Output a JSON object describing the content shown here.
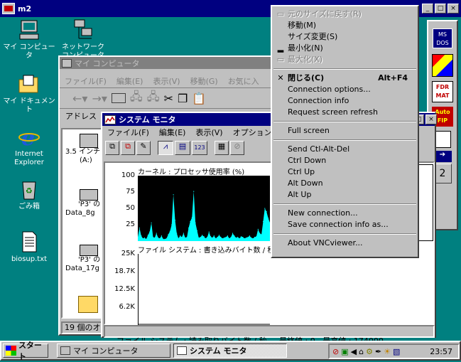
{
  "desktop": {
    "icons": [
      {
        "label1": "マイ コンピュータ",
        "label2": ""
      },
      {
        "label1": "ネットワーク",
        "label2": "コンピュータ"
      },
      {
        "label1": "マイ ドキュメント",
        "label2": ""
      },
      {
        "label1": "Internet",
        "label2": "Explorer"
      },
      {
        "label1": "ごみ箱",
        "label2": ""
      },
      {
        "label1": "biosup.txt",
        "label2": ""
      }
    ],
    "right_icons": [
      "MS DOS",
      "",
      "FDR MAT",
      "Auto FIP",
      "",
      ""
    ]
  },
  "vnc": {
    "title": "m2"
  },
  "mycomputer": {
    "title": "マイ コンピュータ",
    "menu": [
      "ファイル(F)",
      "編集(E)",
      "表示(V)",
      "移動(G)",
      "お気に入"
    ],
    "address_label": "アドレス",
    "items": [
      {
        "l1": "3.5 インチ",
        "l2": "(A:)"
      },
      {
        "l1": "'P3' の",
        "l2": "Data_8g"
      },
      {
        "l1": "'P3' の",
        "l2": "Data_17g"
      }
    ],
    "status": "19 個のオ"
  },
  "sysmon": {
    "title": "システム モニタ",
    "menu": [
      "ファイル(F)",
      "編集(E)",
      "表示(V)",
      "オプション(O)"
    ],
    "chart1_title": "カーネル : プロセッサ使用率 (%)",
    "chart2_title": "ファイル システム : 書き込みバイト数 / 秒",
    "status": "ファイル システム : 読み取りバイト数 / 秒     最終値 : 0   最高値 : 174000",
    "toolbar_text": "123"
  },
  "chart_data": [
    {
      "type": "area",
      "title": "カーネル : プロセッサ使用率 (%)",
      "yticks": [
        "100",
        "75",
        "50",
        "25"
      ],
      "ylim": [
        0,
        100
      ],
      "values": [
        6,
        20,
        8,
        4,
        5,
        3,
        9,
        14,
        28,
        6,
        5,
        12,
        5,
        4,
        8,
        3,
        3,
        4,
        10,
        15,
        25,
        71,
        32,
        12,
        4,
        8,
        6,
        12,
        5,
        6,
        20,
        30,
        36,
        76,
        28,
        16,
        5,
        6,
        9,
        7,
        4,
        6,
        14,
        7,
        5,
        8,
        4,
        6,
        9,
        6,
        4,
        5,
        6,
        8,
        4,
        6,
        12,
        8,
        5,
        6,
        4,
        7,
        6,
        4,
        5,
        6,
        8,
        5,
        4,
        6,
        7,
        18,
        12,
        10,
        30,
        50,
        45,
        35,
        28
      ]
    },
    {
      "type": "line",
      "title": "ファイル システム : 書き込みバイト数 / 秒",
      "yticks": [
        "25K",
        "18.7K",
        "12.5K",
        "6.2K"
      ],
      "ylim": [
        0,
        25000
      ],
      "values": []
    }
  ],
  "context_menu": {
    "items": [
      {
        "label": "元のサイズに戻す(R)",
        "disabled": true,
        "icon": "restore",
        "shortcut": ""
      },
      {
        "label": "移動(M)",
        "disabled": false,
        "icon": "",
        "shortcut": ""
      },
      {
        "label": "サイズ変更(S)",
        "disabled": false,
        "icon": "",
        "shortcut": ""
      },
      {
        "label": "最小化(N)",
        "disabled": false,
        "icon": "minimize",
        "shortcut": ""
      },
      {
        "label": "最大化(X)",
        "disabled": true,
        "icon": "maximize",
        "shortcut": ""
      },
      {
        "sep": true
      },
      {
        "label": "閉じる(C)",
        "disabled": false,
        "icon": "close",
        "shortcut": "Alt+F4",
        "bold": true
      },
      {
        "label": "Connection options...",
        "disabled": false,
        "icon": "",
        "shortcut": ""
      },
      {
        "label": "Connection info",
        "disabled": false,
        "icon": "",
        "shortcut": ""
      },
      {
        "label": "Request screen refresh",
        "disabled": false,
        "icon": "",
        "shortcut": ""
      },
      {
        "sep": true
      },
      {
        "label": "Full screen",
        "disabled": false,
        "icon": "",
        "shortcut": ""
      },
      {
        "sep": true
      },
      {
        "label": "Send Ctl-Alt-Del",
        "disabled": false,
        "icon": "",
        "shortcut": ""
      },
      {
        "label": "Ctrl Down",
        "disabled": false,
        "icon": "",
        "shortcut": ""
      },
      {
        "label": "Ctrl Up",
        "disabled": false,
        "icon": "",
        "shortcut": ""
      },
      {
        "label": "Alt Down",
        "disabled": false,
        "icon": "",
        "shortcut": ""
      },
      {
        "label": "Alt Up",
        "disabled": false,
        "icon": "",
        "shortcut": ""
      },
      {
        "sep": true
      },
      {
        "label": "New connection...",
        "disabled": false,
        "icon": "",
        "shortcut": ""
      },
      {
        "label": "Save connection info as...",
        "disabled": false,
        "icon": "",
        "shortcut": ""
      },
      {
        "sep": true
      },
      {
        "label": "About VNCviewer...",
        "disabled": false,
        "icon": "",
        "shortcut": ""
      }
    ]
  },
  "taskbar": {
    "start": "スタート",
    "tasks": [
      "マイ コンピュータ",
      "システム モニタ"
    ],
    "clock": "23:57"
  },
  "colors": {
    "desktop": "#008080",
    "title_active": "#000080",
    "chart_fill": "#00ffff",
    "chart_bg": "#000000"
  }
}
